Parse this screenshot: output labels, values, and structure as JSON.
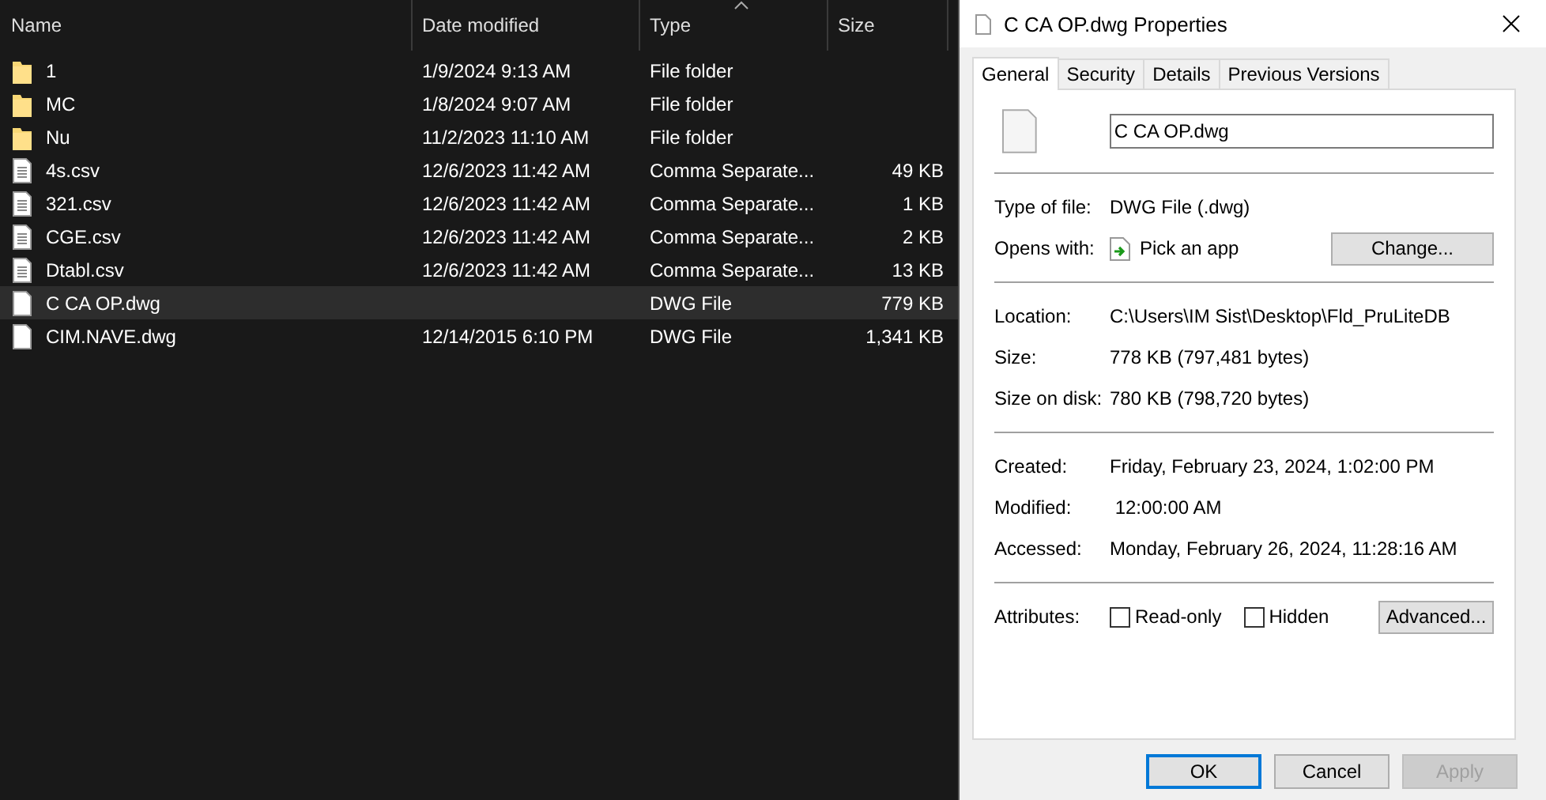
{
  "explorer": {
    "columns": [
      {
        "label": "Name",
        "sorted": false
      },
      {
        "label": "Date modified",
        "sorted": false
      },
      {
        "label": "Type",
        "sorted": true
      },
      {
        "label": "Size",
        "sorted": false
      }
    ],
    "rows": [
      {
        "kind": "folder",
        "name": "1",
        "date_modified": "1/9/2024 9:13 AM",
        "type": "File folder",
        "size": "",
        "selected": false
      },
      {
        "kind": "folder",
        "name": "MC",
        "date_modified": "1/8/2024 9:07 AM",
        "type": "File folder",
        "size": "",
        "selected": false
      },
      {
        "kind": "folder",
        "name": "Nu",
        "date_modified": "11/2/2023 11:10 AM",
        "type": "File folder",
        "size": "",
        "selected": false
      },
      {
        "kind": "document",
        "name": "4s.csv",
        "date_modified": "12/6/2023 11:42 AM",
        "type": "Comma Separate...",
        "size": "49 KB",
        "selected": false
      },
      {
        "kind": "document",
        "name": "321.csv",
        "date_modified": "12/6/2023 11:42 AM",
        "type": "Comma Separate...",
        "size": "1 KB",
        "selected": false
      },
      {
        "kind": "document",
        "name": "CGE.csv",
        "date_modified": "12/6/2023 11:42 AM",
        "type": "Comma Separate...",
        "size": "2 KB",
        "selected": false
      },
      {
        "kind": "document",
        "name": "Dtabl.csv",
        "date_modified": "12/6/2023 11:42 AM",
        "type": "Comma Separate...",
        "size": "13 KB",
        "selected": false
      },
      {
        "kind": "file",
        "name": "C CA OP.dwg",
        "date_modified": "",
        "type": "DWG File",
        "size": "779 KB",
        "selected": true
      },
      {
        "kind": "file",
        "name": "CIM.NAVE.dwg",
        "date_modified": "12/14/2015 6:10 PM",
        "type": "DWG File",
        "size": "1,341 KB",
        "selected": false
      }
    ]
  },
  "dialog": {
    "title": "C CA OP.dwg Properties",
    "tabs": [
      {
        "label": "General",
        "selected": true
      },
      {
        "label": "Security",
        "selected": false
      },
      {
        "label": "Details",
        "selected": false
      },
      {
        "label": "Previous Versions",
        "selected": false
      }
    ],
    "file_name": "C CA OP.dwg",
    "groups": [
      [
        {
          "kind": "text",
          "label": "Type of file:",
          "value": "DWG File (.dwg)"
        },
        {
          "kind": "app",
          "label": "Opens with:",
          "value": "Pick an app",
          "button": "Change..."
        }
      ],
      [
        {
          "kind": "text",
          "label": "Location:",
          "value": "C:\\Users\\IM Sist\\Desktop\\Fld_PruLiteDB"
        },
        {
          "kind": "text",
          "label": "Size:",
          "value": "778 KB (797,481 bytes)"
        },
        {
          "kind": "text",
          "label": "Size on disk:",
          "value": "780 KB (798,720 bytes)"
        }
      ],
      [
        {
          "kind": "text",
          "label": "Created:",
          "value": "Friday, February 23, 2024, 1:02:00 PM"
        },
        {
          "kind": "text",
          "label": "Modified:",
          "value": " 12:00:00 AM"
        },
        {
          "kind": "text",
          "label": "Accessed:",
          "value": "Monday, February 26, 2024, 11:28:16 AM"
        }
      ],
      [
        {
          "kind": "attributes",
          "label": "Attributes:",
          "options": [
            {
              "label": "Read-only",
              "checked": false
            },
            {
              "label": "Hidden",
              "checked": false
            }
          ],
          "button": "Advanced..."
        }
      ]
    ],
    "buttons": [
      {
        "label": "OK",
        "default": true,
        "disabled": false
      },
      {
        "label": "Cancel",
        "default": false,
        "disabled": false
      },
      {
        "label": "Apply",
        "default": false,
        "disabled": true
      }
    ]
  }
}
